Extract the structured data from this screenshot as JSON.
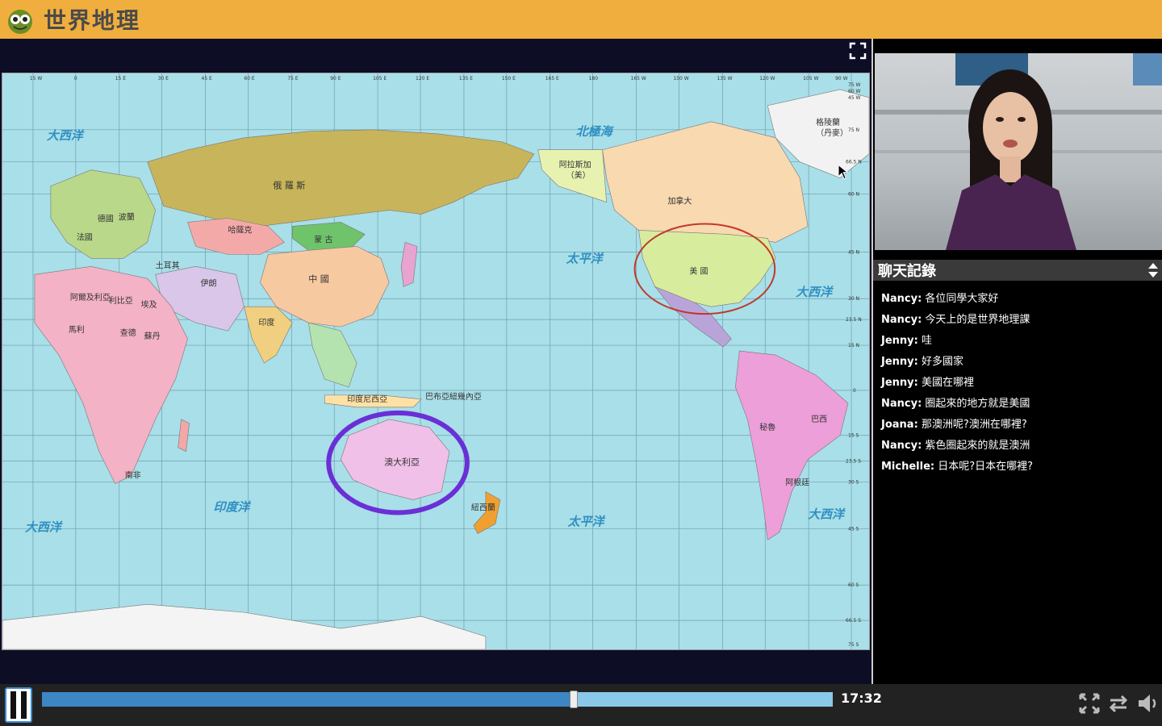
{
  "app": {
    "title": "世界地理",
    "logo_icon": "owl-logo-icon"
  },
  "map": {
    "oceans": [
      {
        "label": "大西洋"
      },
      {
        "label": "北極海"
      },
      {
        "label": "太平洋"
      },
      {
        "label": "大西洋"
      },
      {
        "label": "印度洋"
      },
      {
        "label": "大西洋"
      },
      {
        "label": "太平洋"
      },
      {
        "label": "大西洋"
      }
    ],
    "countries": {
      "russia": "俄 羅 斯",
      "kazakhstan": "哈薩克",
      "mongolia": "蒙 古",
      "china": "中 國",
      "india": "印度",
      "canada": "加拿大",
      "usa": "美 國",
      "alaska": "阿拉斯加",
      "alaska_note": "（美）",
      "greenland": "格陵蘭",
      "greenland_note": "（丹麥）",
      "australia": "澳大利亞",
      "brazil": "巴西",
      "peru": "秘魯",
      "argentina": "阿根廷",
      "south_africa": "南非",
      "egypt": "埃及",
      "sudan": "蘇丹",
      "iran": "伊朗",
      "algeria": "阿爾及利亞",
      "libya": "利比亞",
      "mali": "馬利",
      "chad": "查德",
      "france": "法國",
      "germany": "德國",
      "poland": "波蘭",
      "turkey": "土耳其",
      "new_zealand": "紐西蘭",
      "papua": "巴布亞紐幾內亞",
      "indonesia": "印度尼西亞"
    },
    "annotations": [
      {
        "target": "美國",
        "color": "#c0392b"
      },
      {
        "target": "澳大利亞",
        "color": "#6a2fd6"
      }
    ],
    "top_ticks": [
      "15 W",
      "0",
      "15 E",
      "30 E",
      "45 E",
      "60 E",
      "75 E",
      "90 E",
      "105 E",
      "120 E",
      "135 E",
      "150 E",
      "165 E",
      "180",
      "165 W",
      "150 W",
      "135 W",
      "120 W",
      "105 W",
      "90 W",
      "75 W",
      "60 W",
      "45 W"
    ],
    "right_ticks": [
      "75 N",
      "66.5 N",
      "60 N",
      "45 N",
      "30 N",
      "23.5 N",
      "15 N",
      "0",
      "15 S",
      "23.5 S",
      "30 S",
      "45 S",
      "60 S",
      "66.5 S",
      "75 S"
    ]
  },
  "chat": {
    "title": "聊天記錄",
    "messages": [
      {
        "user": "Nancy:",
        "text": " 各位同學大家好"
      },
      {
        "user": "Nancy:",
        "text": " 今天上的是世界地理課"
      },
      {
        "user": "Jenny:",
        "text": " 哇"
      },
      {
        "user": "Jenny:",
        "text": " 好多國家"
      },
      {
        "user": "Jenny:",
        "text": " 美國在哪裡"
      },
      {
        "user": "Nancy:",
        "text": " 圈起來的地方就是美國"
      },
      {
        "user": "Joana:",
        "text": " 那澳洲呢?澳洲在哪裡?"
      },
      {
        "user": "Nancy:",
        "text": " 紫色圈起來的就是澳洲"
      },
      {
        "user": "Michelle:",
        "text": " 日本呢?日本在哪裡?"
      }
    ]
  },
  "player": {
    "time": "17:32",
    "progress_fraction": 0.672,
    "colors": {
      "track": "#8ac8ea",
      "fill": "#3c86c4"
    }
  }
}
